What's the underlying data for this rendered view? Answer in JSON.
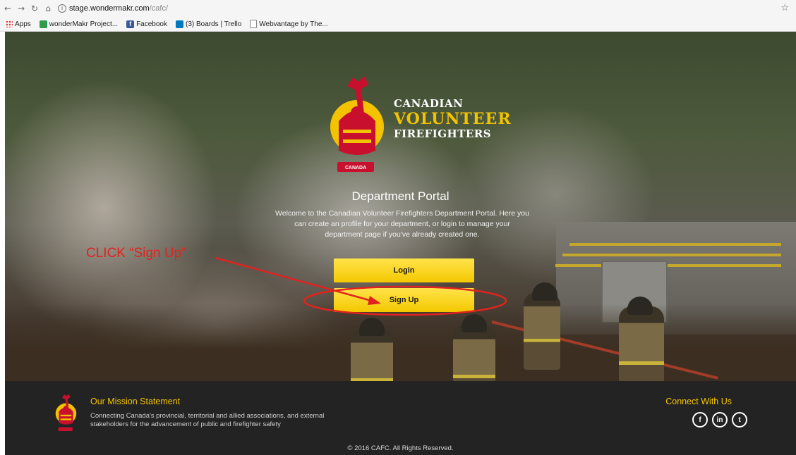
{
  "browser": {
    "url_host": "stage.wondermakr.com",
    "url_path": "/cafc/",
    "bookmarks": [
      {
        "label": "Apps",
        "icon": "apps-grid-icon"
      },
      {
        "label": "wonderMakr Project...",
        "icon": "sheets-icon"
      },
      {
        "label": "Facebook",
        "icon": "facebook-icon"
      },
      {
        "label": "(3) Boards | Trello",
        "icon": "trello-icon"
      },
      {
        "label": "Webvantage by The...",
        "icon": "document-icon"
      }
    ]
  },
  "logo": {
    "line1": "CANADIAN",
    "line2": "VOLUNTEER",
    "line3": "FIREFIGHTERS",
    "badge": "CANADA",
    "accent_color": "#f4c300"
  },
  "portal": {
    "title": "Department Portal",
    "intro": "Welcome to the Canadian Volunteer Firefighters Department Portal. Here you can create an profile for your department, or login to manage your department page if you've already created one.",
    "login_label": "Login",
    "signup_label": "Sign Up"
  },
  "annotation": {
    "text": "CLICK “Sign Up”",
    "color": "#e0231f"
  },
  "footer": {
    "mission_title": "Our Mission Statement",
    "mission_text": "Connecting Canada's provincial, territorial and allied associations, and external stakeholders for the advancement of public and firefighter safety",
    "connect_title": "Connect With Us",
    "social": [
      {
        "label": "f",
        "icon": "facebook-icon"
      },
      {
        "label": "in",
        "icon": "linkedin-icon"
      },
      {
        "label": "t",
        "icon": "twitter-icon"
      }
    ],
    "copyright": "© 2016 CAFC. All Rights Reserved."
  }
}
